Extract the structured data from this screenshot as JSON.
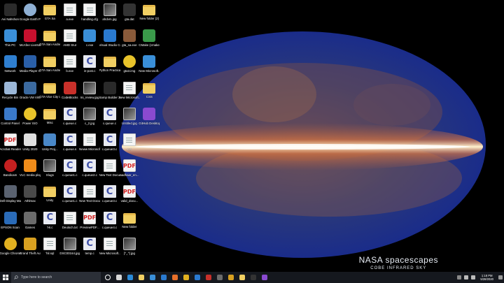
{
  "desktop": {
    "icons": [
      {
        "label": "Avi Nahshon",
        "kind": "app",
        "color": "#2b2b2b"
      },
      {
        "label": "This PC",
        "kind": "app",
        "color": "#3a8fd8"
      },
      {
        "label": "Network",
        "kind": "app",
        "color": "#2f7fd0"
      },
      {
        "label": "Recycle Bin",
        "kind": "app",
        "color": "#9bb7d8"
      },
      {
        "label": "Control Panel",
        "kind": "app",
        "color": "#3a79c9"
      },
      {
        "label": "Acrobat Reader DC",
        "kind": "pdf",
        "color": "#d32222"
      },
      {
        "label": "Bandicam",
        "kind": "round",
        "color": "#c42020"
      },
      {
        "label": "Dell Display Manager",
        "kind": "app",
        "color": "#5a6270"
      },
      {
        "label": "EPSON Scan",
        "kind": "app",
        "color": "#2a6bb8"
      },
      {
        "label": "Google Chrome",
        "kind": "round",
        "color": "#e1b020"
      },
      {
        "label": "Google Earth Pro",
        "kind": "round",
        "color": "#8fb0d4"
      },
      {
        "label": "McAfee LiveSafe",
        "kind": "app",
        "color": "#c8102e"
      },
      {
        "label": "Media Player Classic",
        "kind": "app",
        "color": "#2a5fa8"
      },
      {
        "label": "Oracle VM VirtualBox",
        "kind": "app",
        "color": "#3b6aa0"
      },
      {
        "label": "Power ISO",
        "kind": "round",
        "color": "#e8c32a"
      },
      {
        "label": "Unity 2020",
        "kind": "app",
        "color": "#e0e0e0"
      },
      {
        "label": "VLC media player",
        "kind": "app",
        "color": "#f08c1a"
      },
      {
        "label": "Athlmax",
        "kind": "app",
        "color": "#4a4a4a"
      },
      {
        "label": "Games",
        "kind": "app",
        "color": "#6b6b6b"
      },
      {
        "label": "Grand Theft Auto Vice...",
        "kind": "app",
        "color": "#d8a020"
      },
      {
        "label": "GTA Sa",
        "kind": "folder",
        "color": ""
      },
      {
        "label": "GTA San Andreas",
        "kind": "folder",
        "color": ""
      },
      {
        "label": "GTA San Andreas Us...",
        "kind": "folder",
        "color": ""
      },
      {
        "label": "GTA Vice City User Files",
        "kind": "folder",
        "color": ""
      },
      {
        "label": "Misc",
        "kind": "folder",
        "color": ""
      },
      {
        "label": "Unity Proj...",
        "kind": "app",
        "color": "#4a88c8"
      },
      {
        "label": "Slugs",
        "kind": "img",
        "color": ""
      },
      {
        "label": "Unity",
        "kind": "folder",
        "color": ""
      },
      {
        "label": "'Hi.c",
        "kind": "c",
        "color": ""
      },
      {
        "label": "'hil.sql",
        "kind": "doc",
        "color": ""
      },
      {
        "label": "a.exe",
        "kind": "doc",
        "color": ""
      },
      {
        "label": "AMD SIuI",
        "kind": "doc",
        "color": ""
      },
      {
        "label": "b.exe",
        "kind": "doc",
        "color": ""
      },
      {
        "label": "CodeBlocks",
        "kind": "app",
        "color": "#c8302a"
      },
      {
        "label": "c.queue.c",
        "kind": "c",
        "color": ""
      },
      {
        "label": "c.queue.s",
        "kind": "c",
        "color": ""
      },
      {
        "label": "c.queue1.c",
        "kind": "c",
        "color": ""
      },
      {
        "label": "c.queue1.c",
        "kind": "c",
        "color": ""
      },
      {
        "label": "Deutsch.txt",
        "kind": "doc",
        "color": ""
      },
      {
        "label": "DSC00164.jpg",
        "kind": "img",
        "color": ""
      },
      {
        "label": "handling.cfg",
        "kind": "doc",
        "color": ""
      },
      {
        "label": "c.exe",
        "kind": "app",
        "color": "#3a8fd8"
      },
      {
        "label": "in-post.c",
        "kind": "c",
        "color": ""
      },
      {
        "label": "Ini_review.jpg",
        "kind": "img",
        "color": ""
      },
      {
        "label": "c_2.jpg",
        "kind": "img",
        "color": ""
      },
      {
        "label": "Neww Microsoft...",
        "kind": "doc",
        "color": ""
      },
      {
        "label": "c.queue2.c",
        "kind": "c",
        "color": ""
      },
      {
        "label": "New Text Docume...",
        "kind": "doc",
        "color": ""
      },
      {
        "label": "PreviewPDF...",
        "kind": "pdf",
        "color": ""
      },
      {
        "label": "temp.c",
        "kind": "c",
        "color": ""
      },
      {
        "label": "ahdvm.jpg",
        "kind": "img",
        "color": ""
      },
      {
        "label": "Visual Studio Code",
        "kind": "app",
        "color": "#2a7ad0"
      },
      {
        "label": "Python Practicals",
        "kind": "folder",
        "color": ""
      },
      {
        "label": "Samp Builder 3",
        "kind": "app",
        "color": "#2a2a2a"
      },
      {
        "label": "c.queue.c",
        "kind": "c",
        "color": ""
      },
      {
        "label": "c.queue3.c",
        "kind": "c",
        "color": ""
      },
      {
        "label": "New Text Docume...",
        "kind": "doc",
        "color": ""
      },
      {
        "label": "c.queue3.c",
        "kind": "c",
        "color": ""
      },
      {
        "label": "c.queue4.c",
        "kind": "c",
        "color": ""
      },
      {
        "label": "New Microsoft...",
        "kind": "doc",
        "color": ""
      },
      {
        "label": "gta.dat",
        "kind": "app",
        "color": "#333333"
      },
      {
        "label": "gta_sa.exe",
        "kind": "app",
        "color": "#8a5a3a"
      },
      {
        "label": "gta3.img",
        "kind": "round",
        "color": "#e8c32a"
      },
      {
        "label": "New Microsoft...",
        "kind": "doc",
        "color": ""
      },
      {
        "label": "Untitled.jpg",
        "kind": "img",
        "color": ""
      },
      {
        "label": "c.s",
        "kind": "doc",
        "color": ""
      },
      {
        "label": "aadhaar_en...",
        "kind": "pdf",
        "color": ""
      },
      {
        "label": "valid_docu...",
        "kind": "pdf",
        "color": ""
      },
      {
        "label": "New folder",
        "kind": "folder",
        "color": ""
      },
      {
        "label": "[^_^] jpg",
        "kind": "img",
        "color": ""
      },
      {
        "label": "New folder (2)",
        "kind": "folder",
        "color": ""
      },
      {
        "label": "CMake (cmake-gui)",
        "kind": "app",
        "color": "#3a9a4a"
      },
      {
        "label": "New Microsoft...",
        "kind": "app",
        "color": "#3a8fd8"
      },
      {
        "label": "CSS",
        "kind": "folder",
        "color": ""
      },
      {
        "label": "GitHub Desktop",
        "kind": "app",
        "color": "#8a4ad0"
      }
    ]
  },
  "wallpaper": {
    "title": "NASA spacescapes",
    "subtitle": "COBE INFRARED SKY"
  },
  "taskbar": {
    "search_placeholder": "Type here to search",
    "apps": [
      {
        "name": "cortana-icon",
        "color": "#ffffff"
      },
      {
        "name": "task-view-icon",
        "color": "#d8d8d8"
      },
      {
        "name": "edge-icon",
        "color": "#2a8ad8"
      },
      {
        "name": "file-explorer-icon",
        "color": "#f1cf63"
      },
      {
        "name": "store-icon",
        "color": "#3a8fd8"
      },
      {
        "name": "mail-icon",
        "color": "#2a7ad0"
      },
      {
        "name": "firefox-icon",
        "color": "#e8702a"
      },
      {
        "name": "chrome-icon",
        "color": "#e1b020"
      },
      {
        "name": "vscode-icon",
        "color": "#2a7ad0"
      },
      {
        "name": "codeblocks-icon",
        "color": "#c8302a"
      },
      {
        "name": "calculator-icon",
        "color": "#6b6b6b"
      },
      {
        "name": "gta-icon",
        "color": "#d8a020"
      },
      {
        "name": "explorer-icon",
        "color": "#f1cf63"
      },
      {
        "name": "cmd-icon",
        "color": "#333333"
      },
      {
        "name": "media-icon",
        "color": "#8a4ad0"
      }
    ],
    "clock_time": "1:18 PM",
    "clock_date": "5/28/2020"
  }
}
